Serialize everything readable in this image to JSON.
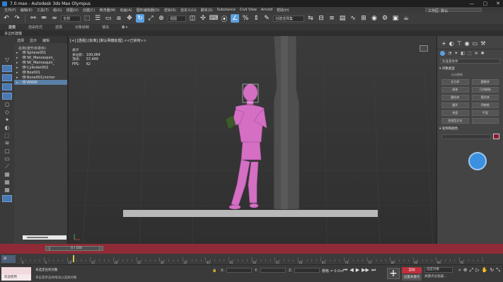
{
  "window": {
    "title": "7.0.max - Autodesk 3ds Max Olympus",
    "min": "—",
    "max": "▢",
    "close": "✕"
  },
  "menu": {
    "items": [
      "文件(F)",
      "编辑(E)",
      "工具(T)",
      "组(G)",
      "视图(V)",
      "创建(C)",
      "修改器(M)",
      "动画(A)",
      "图形编辑器(D)",
      "渲染(R)",
      "自定义(U)",
      "脚本(S)",
      "Substance",
      "Civil View",
      "Arnold",
      "帮助(H)"
    ],
    "workspace": "工作区: 默认"
  },
  "toolbar": {
    "selection_filter": "全部",
    "ref_coord": "视图",
    "named_selection": "创建选择集"
  },
  "ribbon": {
    "tabs": [
      "建模",
      "自由形式",
      "选择",
      "对象绘制",
      "填充"
    ],
    "sub_label": "多边形建模"
  },
  "explorer": {
    "tabs": [
      "选择",
      "显示",
      "编辑"
    ],
    "sort_label": "名称(按升序排序)",
    "items": [
      {
        "name": "Sphere001",
        "selected": false
      },
      {
        "name": "SK_Mannequin_",
        "selected": false
      },
      {
        "name": "SK_Mannequin_",
        "selected": false
      },
      {
        "name": "Cylinder002",
        "selected": false
      },
      {
        "name": "Box001",
        "selected": false
      },
      {
        "name": "Bone001(mirror",
        "selected": false
      },
      {
        "name": "WWW",
        "selected": true
      }
    ]
  },
  "viewport": {
    "label": "[+] [透视] [标准] [默认明暗处理]",
    "label_extra": "<<已禁用>>",
    "stats": [
      {
        "k": "总计",
        "v": ""
      },
      {
        "k": "多边形:",
        "v": "100,064"
      },
      {
        "k": "顶点:",
        "v": "57,449"
      },
      {
        "k": "",
        "v": ""
      },
      {
        "k": "FPS:",
        "v": "62"
      }
    ]
  },
  "command_panel": {
    "category": "标准基本体",
    "section_object_type": "对象类型",
    "autogrid": "自动栅格",
    "buttons": [
      "长方体",
      "圆锥体",
      "球体",
      "几何球体",
      "圆柱体",
      "管状体",
      "圆环",
      "四棱锥",
      "茶壶",
      "平面",
      "加强型文本",
      ""
    ],
    "section_name_color": "名称和颜色",
    "name_value": "",
    "swatch_color": "#8b1a2d"
  },
  "timeslider": {
    "position": "0 / 100",
    "current_frame": 0,
    "total_frames": 100
  },
  "trackbar": {
    "ticks": [
      "0",
      "5",
      "10",
      "15",
      "20",
      "25",
      "30",
      "35",
      "40",
      "45",
      "50",
      "55",
      "60",
      "65",
      "70",
      "75",
      "80",
      "85",
      "90",
      "95",
      "100"
    ]
  },
  "status": {
    "script_label": "",
    "maxscript_prompt": "欢迎使用 MAXScript。",
    "message_top": "未选定任何对象",
    "message_bottom": "单击或单击并拖动以选择对象",
    "x_label": "X:",
    "y_label": "Y:",
    "z_label": "Z:",
    "grid": "栅格 = 0.0m",
    "autokey_label": "自动",
    "setkey_label": "设置关键点",
    "selected_label": "选定对象",
    "filters_label": "关键点过滤器..."
  },
  "colors": {
    "accent": "#5aa0e0",
    "timeslider": "#8f2b36",
    "mannequin": "#d46fc4",
    "selection_row": "#5a7fa8"
  }
}
